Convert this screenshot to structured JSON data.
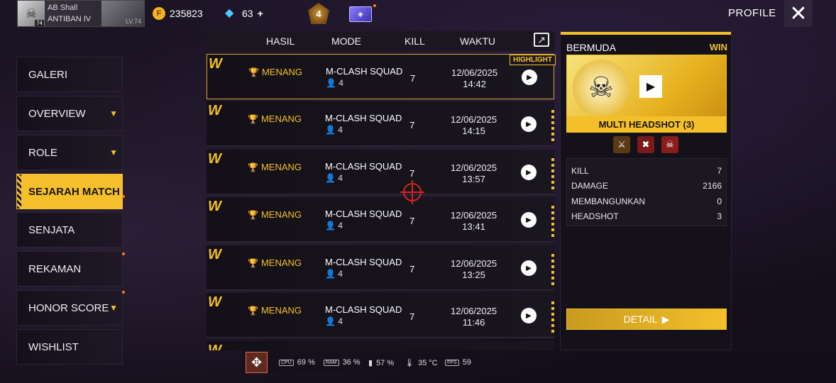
{
  "profile": {
    "name_top": "AB Shall",
    "name_bottom": "ANTIBAN IV",
    "avatar_level": "74",
    "badge_level": "LV.74",
    "coin_amount": "235823",
    "diamond_amount": "63",
    "diamond_plus": "+",
    "rank_number": "4",
    "header_label": "PROFILE",
    "close_icon": "close-icon"
  },
  "sidebar": {
    "items": [
      {
        "label": "GALERI",
        "chevron": false,
        "active": false
      },
      {
        "label": "OVERVIEW",
        "chevron": true,
        "active": false
      },
      {
        "label": "ROLE",
        "chevron": true,
        "active": false
      },
      {
        "label": "SEJARAH MATCH",
        "chevron": false,
        "active": true
      },
      {
        "label": "SENJATA",
        "chevron": false,
        "active": false
      },
      {
        "label": "REKAMAN",
        "chevron": false,
        "active": false
      },
      {
        "label": "HONOR SCORE",
        "chevron": true,
        "active": false
      },
      {
        "label": "WISHLIST",
        "chevron": false,
        "active": false
      }
    ]
  },
  "table": {
    "headers": {
      "hasil": "HASIL",
      "mode": "MODE",
      "kill": "KILL",
      "waktu": "WAKTU"
    },
    "highlight_badge": "HIGHLIGHT",
    "rows": [
      {
        "result": "MENANG",
        "mode": "M-CLASH SQUAD",
        "players": "4",
        "kill": "7",
        "date": "12/06/2025",
        "time": "14:42"
      },
      {
        "result": "MENANG",
        "mode": "M-CLASH SQUAD",
        "players": "4",
        "kill": "7",
        "date": "12/06/2025",
        "time": "14:15"
      },
      {
        "result": "MENANG",
        "mode": "M-CLASH SQUAD",
        "players": "4",
        "kill": "7",
        "date": "12/06/2025",
        "time": "13:57"
      },
      {
        "result": "MENANG",
        "mode": "M-CLASH SQUAD",
        "players": "4",
        "kill": "7",
        "date": "12/06/2025",
        "time": "13:41"
      },
      {
        "result": "MENANG",
        "mode": "M-CLASH SQUAD",
        "players": "4",
        "kill": "7",
        "date": "12/06/2025",
        "time": "13:25"
      },
      {
        "result": "MENANG",
        "mode": "M-CLASH SQUAD",
        "players": "4",
        "kill": "7",
        "date": "12/06/2025",
        "time": "11:46"
      }
    ]
  },
  "detail": {
    "map": "BERMUDA",
    "result": "WIN",
    "caption": "MULTI HEADSHOT (3)",
    "stats": [
      {
        "label": "KILL",
        "value": "7"
      },
      {
        "label": "DAMAGE",
        "value": "2166"
      },
      {
        "label": "MEMBANGUNKAN",
        "value": "0"
      },
      {
        "label": "HEADSHOT",
        "value": "3"
      }
    ],
    "button": "DETAIL"
  },
  "performance": {
    "cpu_label": "CPU",
    "cpu": "69 %",
    "ram_label": "RAM",
    "ram": "36 %",
    "battery": "57 %",
    "temp": "35 °C",
    "fps_label": "FPS",
    "fps": "59"
  },
  "colors": {
    "accent": "#f3c02a",
    "bg": "#120d18",
    "crosshair": "#d2251f"
  }
}
